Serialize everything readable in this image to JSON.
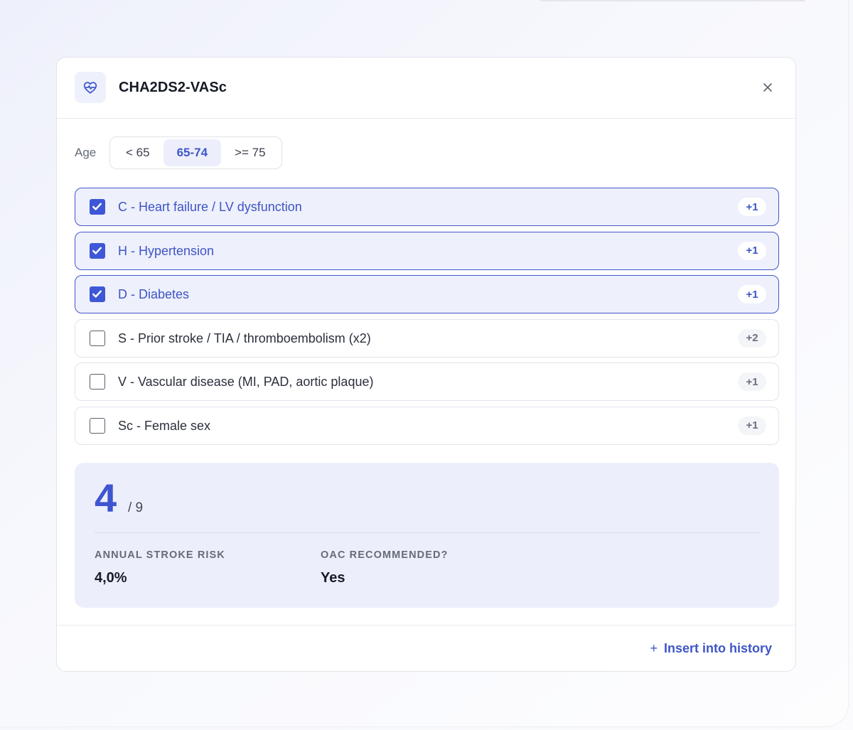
{
  "calculator": {
    "title": "CHA2DS2-VASc",
    "close_glyph": "×",
    "header_icon": "heart-pulse-icon"
  },
  "age": {
    "label": "Age",
    "options": [
      "< 65",
      "65-74",
      ">= 75"
    ],
    "selected": "65-74"
  },
  "criteria": [
    {
      "label": "C - Heart failure / LV dysfunction",
      "points": "+1",
      "checked": true
    },
    {
      "label": "H - Hypertension",
      "points": "+1",
      "checked": true
    },
    {
      "label": "D - Diabetes",
      "points": "+1",
      "checked": true
    },
    {
      "label": "S - Prior stroke / TIA / thromboembolism (x2)",
      "points": "+2",
      "checked": false
    },
    {
      "label": "V - Vascular disease (MI, PAD, aortic plaque)",
      "points": "+1",
      "checked": false
    },
    {
      "label": "Sc - Female sex",
      "points": "+1",
      "checked": false
    }
  ],
  "result": {
    "score": "4",
    "max": "/ 9",
    "stroke_risk_label": "ANNUAL STROKE RISK",
    "stroke_risk_value": "4,0%",
    "oac_label": "OAC RECOMMENDED?",
    "oac_value": "Yes"
  },
  "footer": {
    "insert_plus": "+",
    "insert_label": "Insert into history"
  },
  "colors": {
    "accent": "#3e55cf",
    "checked_bg": "#eef0fc",
    "result_bg": "#eceffb"
  }
}
